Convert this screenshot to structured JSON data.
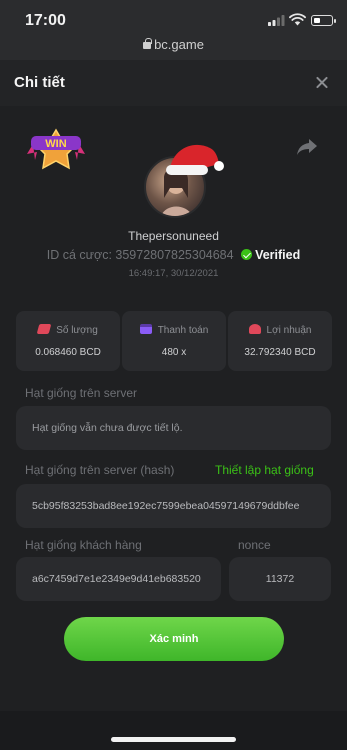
{
  "status_bar": {
    "time": "17:00",
    "url": "bc.game",
    "battery_level": 0.35
  },
  "header": {
    "title": "Chi tiết"
  },
  "bet": {
    "username": "Thepersonuneed",
    "bet_id_label": "ID cá cược:",
    "bet_id": "35972807825304684",
    "verified_label": "Verified",
    "datetime": "16:49:17, 30/12/2021",
    "badge_text": "WIN"
  },
  "stats": [
    {
      "label": "Số lượng",
      "value": "0.068460 BCD",
      "icon": "coins-icon",
      "color": "#e0485a"
    },
    {
      "label": "Thanh toán",
      "value": "480 x",
      "icon": "card-icon",
      "color": "#8a5cf6"
    },
    {
      "label": "Lợi nhuận",
      "value": "32.792340 BCD",
      "icon": "profit-icon",
      "color": "#e0485a"
    }
  ],
  "seeds": {
    "server_seed_label": "Hạt giống trên server",
    "server_seed_value": "Hạt giống vẫn chưa được tiết lộ.",
    "server_hash_label": "Hạt giống trên server (hash)",
    "set_seed_link": "Thiết lập hạt giống",
    "server_hash_value": "5cb95f83253bad8ee192ec7599ebea04597149679ddbfee",
    "client_seed_label": "Hạt giống khách hàng",
    "client_seed_value": "a6c7459d7e1e2349e9d41eb683520",
    "nonce_label": "nonce",
    "nonce_value": "11372"
  },
  "actions": {
    "verify_label": "Xác minh"
  },
  "colors": {
    "accent_green": "#3bc117",
    "background": "#1a1b1d",
    "card": "#2a2b2e"
  }
}
